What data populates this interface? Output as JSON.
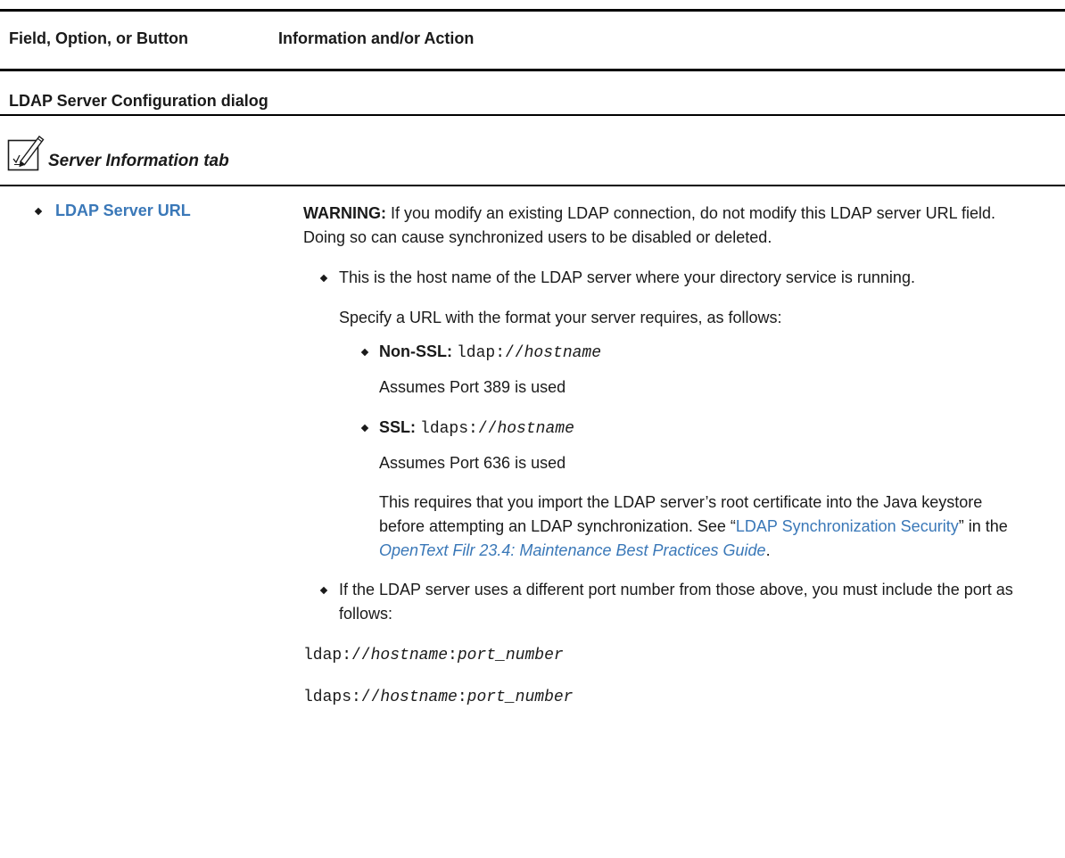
{
  "table": {
    "col1_header": "Field, Option, or Button",
    "col2_header": "Information and/or Action",
    "section_title": "LDAP Server Configuration dialog",
    "tab_title": "Server Information tab",
    "tab_icon": "pencil-checklist-icon"
  },
  "row": {
    "field_label": "LDAP Server URL",
    "warning_label": "WARNING:",
    "warning_text": " If you modify an existing LDAP connection, do not modify this LDAP server URL field. Doing so can cause synchronized users to be disabled or deleted.",
    "bullet1": "This is the host name of the LDAP server where your directory service is running.",
    "specify": "Specify a URL with the format your server requires, as follows:",
    "nonssl_label": "Non-SSL:",
    "nonssl_prefix": "ldap://",
    "nonssl_host": "hostname",
    "nonssl_note": "Assumes Port 389 is used",
    "ssl_label": "SSL:",
    "ssl_prefix": "ldaps://",
    "ssl_host": "hostname",
    "ssl_note": "Assumes Port 636 is used",
    "req_text_1": "This requires that you import the LDAP server’s root certificate into the Java keystore before attempting an LDAP synchronization. See “",
    "req_link": "LDAP Synchronization Security",
    "req_text_2": "” in the ",
    "req_guide": "OpenText Filr 23.4: Maintenance Best Practices Guide",
    "req_text_3": ".",
    "bullet2": "If the LDAP server uses a different port number from those above, you must include the port as follows:",
    "ex1_prefix": "ldap://",
    "ex1_host": "hostname",
    "ex1_sep": ":",
    "ex1_port": "port_number",
    "ex2_prefix": "ldaps://",
    "ex2_host": "hostname",
    "ex2_sep": ":",
    "ex2_port": "port_number"
  },
  "colors": {
    "link": "#3a78b8",
    "text": "#1a1a1a",
    "rule": "#000000"
  }
}
